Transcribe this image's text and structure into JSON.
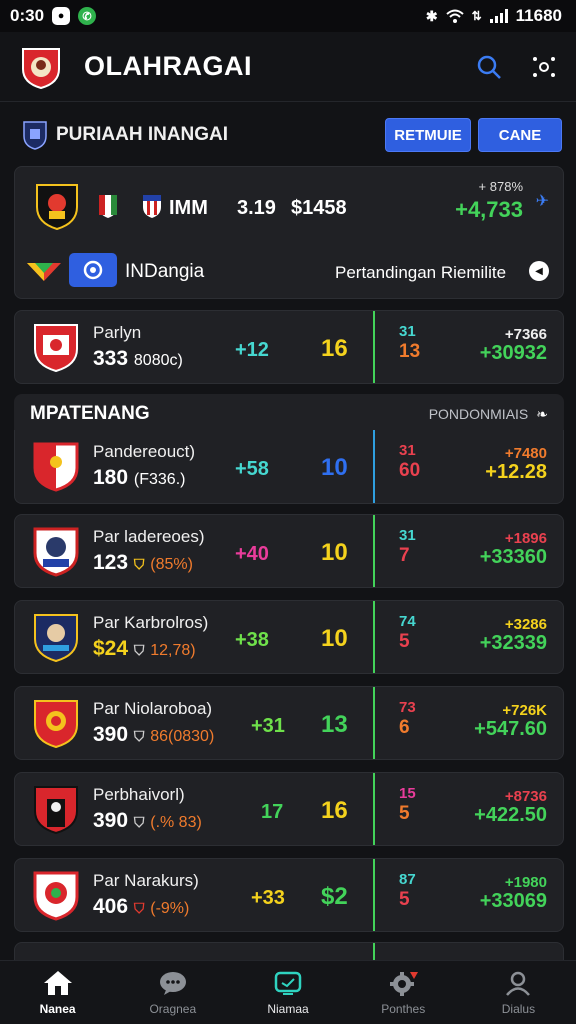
{
  "status": {
    "time": "0:30",
    "clock_right": "11680"
  },
  "header": {
    "title": "OLAHRAGAI"
  },
  "subheader": {
    "title": "PURIAAH INANGAI",
    "btn1": "RETMUIE",
    "btn2": "CANE"
  },
  "featured": {
    "team": "IMM",
    "odds": "3.19",
    "amount": "$1458",
    "pct": "+ 878%",
    "value": "+4,733",
    "league": "INDangia",
    "link": "Pertandingan Riemilite"
  },
  "first_row": {
    "name": "Parlyn",
    "score": "333",
    "score_paren": "8080c)",
    "diff": "+12",
    "pts": "16",
    "small_top": "31",
    "small_big": "13",
    "right_top": "+7366",
    "right_big": "+30932"
  },
  "section": {
    "title": "MPATENANG",
    "link": "PONDONMIAIS"
  },
  "rows": [
    {
      "name": "Pandereouct)",
      "score": "180",
      "score_paren": "(F336.)",
      "diff": "+58",
      "pts": "10",
      "small_top": "31",
      "small_big": "60",
      "right_top": "+7480",
      "right_big": "+12.28"
    },
    {
      "name": "Par ladereoes)",
      "score": "123",
      "score_paren": "(85%)",
      "diff": "+40",
      "pts": "10",
      "small_top": "31",
      "small_big": "7",
      "right_top": "+1896",
      "right_big": "+33360"
    },
    {
      "name": "Par Karbrolros)",
      "score": "$24",
      "score_paren": "12,78)",
      "diff": "+38",
      "pts": "10",
      "small_top": "74",
      "small_big": "5",
      "right_top": "+3286",
      "right_big": "+32339"
    },
    {
      "name": "Par Niolaroboa)",
      "score": "390",
      "score_paren": "86(0830)",
      "diff": "+31",
      "pts": "13",
      "small_top": "73",
      "small_big": "6",
      "right_top": "+726K",
      "right_big": "+547.60"
    },
    {
      "name": "Perbhaivorl)",
      "score": "390",
      "score_paren": "(.% 83)",
      "diff": "17",
      "pts": "16",
      "small_top": "15",
      "small_big": "5",
      "right_top": "+8736",
      "right_big": "+422.50"
    },
    {
      "name": "Par Narakurs)",
      "score": "406",
      "score_paren": "(-9%)",
      "diff": "+33",
      "pts": "$2",
      "small_top": "87",
      "small_big": "5",
      "right_top": "+1980",
      "right_big": "+33069"
    }
  ],
  "nav": [
    {
      "label": "Nanea",
      "icon": "home-icon"
    },
    {
      "label": "Oragnea",
      "icon": "chat-bubble-icon"
    },
    {
      "label": "Niamaa",
      "icon": "tv-icon"
    },
    {
      "label": "Ponthes",
      "icon": "gear-icon"
    },
    {
      "label": "Dialus",
      "icon": "profile-icon"
    }
  ],
  "colors": {
    "accent": "#2f5fe0",
    "green": "#43d35a",
    "yellow": "#f4d21d",
    "orange": "#f07b2d",
    "red": "#e9414f"
  }
}
